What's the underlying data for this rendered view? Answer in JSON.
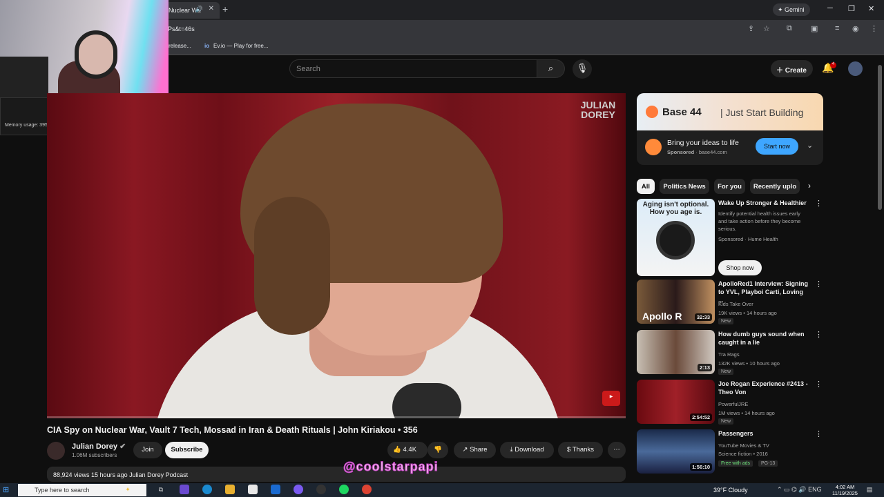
{
  "browser": {
    "tab_title": "Nuclear Wa",
    "tab_audio_icon": "speaker-icon",
    "new_tab": "+",
    "gemini_label": "Gemini",
    "url": "Ps&t=46s",
    "bookmarks": [
      {
        "label": "release..."
      },
      {
        "label": "Ev.io — Play for free..."
      }
    ]
  },
  "overlay": {
    "memory_usage": "Memory usage: 395 MB"
  },
  "youtube_header": {
    "search_placeholder": "Search",
    "create_label": "Create",
    "notification_count": "4"
  },
  "video": {
    "brand_overlay": "JULIAN DOREY",
    "title": "CIA Spy on Nuclear War, Vault 7 Tech, Mossad in Iran & Death Rituals | John Kiriakou • 356",
    "channel_name": "Julian Dorey",
    "subscribers": "1.06M subscribers",
    "join_label": "Join",
    "subscribe_label": "Subscribe",
    "likes": "4.4K",
    "share_label": "Share",
    "download_label": "Download",
    "thanks_label": "Thanks",
    "description_meta": "88,924 views  15 hours ago  Julian Dorey Podcast"
  },
  "watermark": "@coolstarpapi",
  "ad": {
    "brand": "Base 44",
    "tagline": "Just Start Building",
    "headline": "Bring your ideas to life",
    "sponsored": "Sponsored",
    "domain": "base44.com",
    "cta": "Start now"
  },
  "chips": [
    {
      "label": "All"
    },
    {
      "label": "Politics News"
    },
    {
      "label": "For you"
    },
    {
      "label": "Recently uplo"
    }
  ],
  "recommendations": [
    {
      "title": "Wake Up Stronger & Healthier",
      "desc": "Identify potential health issues early and take action before they become serious.",
      "sponsor": "Sponsored · Hume Health",
      "thumb_text": "Aging isn't optional. How you age is.",
      "cta": "Shop now"
    },
    {
      "title": "ApolloRed1 Interview: Signing to YVL, Playboi Carti, Loving ...",
      "channel": "Kids Take Over",
      "meta": "19K views • 14 hours ago",
      "badge": "New",
      "duration": "32:33",
      "thumb_text": "Apollo R"
    },
    {
      "title": "How dumb guys sound when caught in a lie",
      "channel": "Tra Rags",
      "meta": "132K views • 10 hours ago",
      "badge": "New",
      "duration": "2:13"
    },
    {
      "title": "Joe Rogan Experience #2413 - Theo Von",
      "channel": "PowerfulJRE",
      "meta": "1M views • 14 hours ago",
      "badge": "New",
      "duration": "2:54:52"
    },
    {
      "title": "Passengers",
      "channel": "YouTube Movies & TV",
      "meta": "Science fiction • 2016",
      "badge": "Free with ads",
      "badge2": "PG-13",
      "duration": "1:56:10"
    }
  ],
  "taskbar": {
    "search_placeholder": "Type here to search",
    "weather": "39°F  Cloudy",
    "time": "4:02 AM",
    "date": "11/19/2025"
  }
}
